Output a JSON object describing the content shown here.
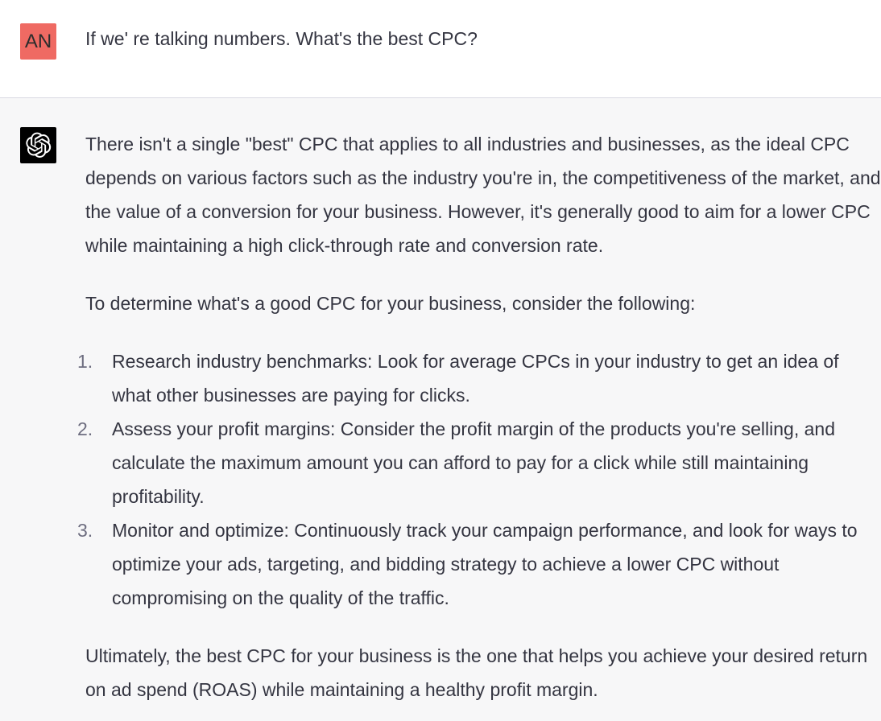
{
  "user_message": {
    "avatar_initials": "AN",
    "text": "If we' re talking numbers. What's the best CPC?"
  },
  "assistant_message": {
    "avatar_icon": "openai-logo-icon",
    "intro": "There isn't a single \"best\" CPC that applies to all industries and businesses, as the ideal CPC depends on various factors such as the industry you're in, the competitiveness of the market, and the value of a conversion for your business. However, it's generally good to aim for a lower CPC while maintaining a high click-through rate and conversion rate.",
    "lead_in": "To determine what's a good CPC for your business, consider the following:",
    "steps": [
      {
        "num": "1.",
        "text": "Research industry benchmarks: Look for average CPCs in your industry to get an idea of what other businesses are paying for clicks."
      },
      {
        "num": "2.",
        "text": "Assess your profit margins: Consider the profit margin of the products you're selling, and calculate the maximum amount you can afford to pay for a click while still maintaining profitability."
      },
      {
        "num": "3.",
        "text": "Monitor and optimize: Continuously track your campaign performance, and look for ways to optimize your ads, targeting, and bidding strategy to achieve a lower CPC without compromising on the quality of the traffic."
      }
    ],
    "conclusion": "Ultimately, the best CPC for your business is the one that helps you achieve your desired return on ad spend (ROAS) while maintaining a healthy profit margin."
  },
  "colors": {
    "user_avatar_bg": "#ef6a63",
    "assistant_row_bg": "#f7f7f8",
    "text": "#343541",
    "list_number": "#6e6e80"
  }
}
